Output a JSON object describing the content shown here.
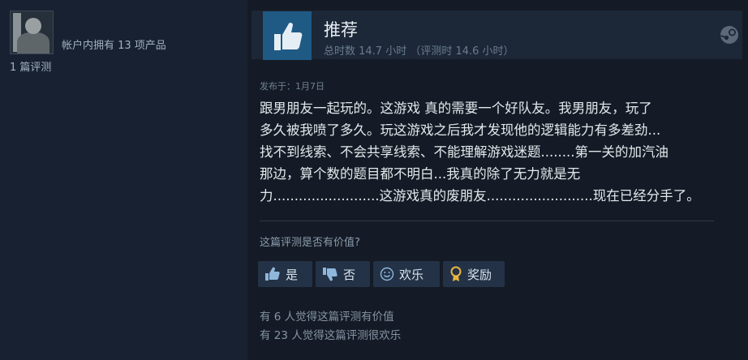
{
  "author": {
    "avatar_icon": "user-avatar",
    "games_owned": "帐户内拥有 13 项产品",
    "reviews": "1 篇评测"
  },
  "review": {
    "verdict": "推荐",
    "verdict_icon": "thumbs-up-icon",
    "hours": "总时数 14.7 小时 （评测时 14.6 小时）",
    "posted": "发布于：1月7日",
    "text_lines": [
      "跟男朋友一起玩的。这游戏 真的需要一个好队友。我男朋友，玩了",
      "多久被我喷了多久。玩这游戏之后我才发现他的逻辑能力有多差劲...",
      "找不到线索、不会共享线索、不能理解游戏迷题........第一关的加汽油",
      "那边，算个数的题目都不明白...我真的除了无力就是无",
      "力.........................这游戏真的废朋友.........................现在已经分手了。"
    ]
  },
  "feedback": {
    "question": "这篇评测是否有价值?",
    "yes_label": "是",
    "no_label": "否",
    "funny_label": "欢乐",
    "award_label": "奖励",
    "helpful_stat": "有 6 人觉得这篇评测有价值",
    "funny_stat": "有 23 人觉得这篇评测很欢乐"
  },
  "colors": {
    "background": "#1a2130",
    "accent_blue": "#1f5a85",
    "button_bg": "#243247",
    "award_gold": "#e8b640"
  }
}
